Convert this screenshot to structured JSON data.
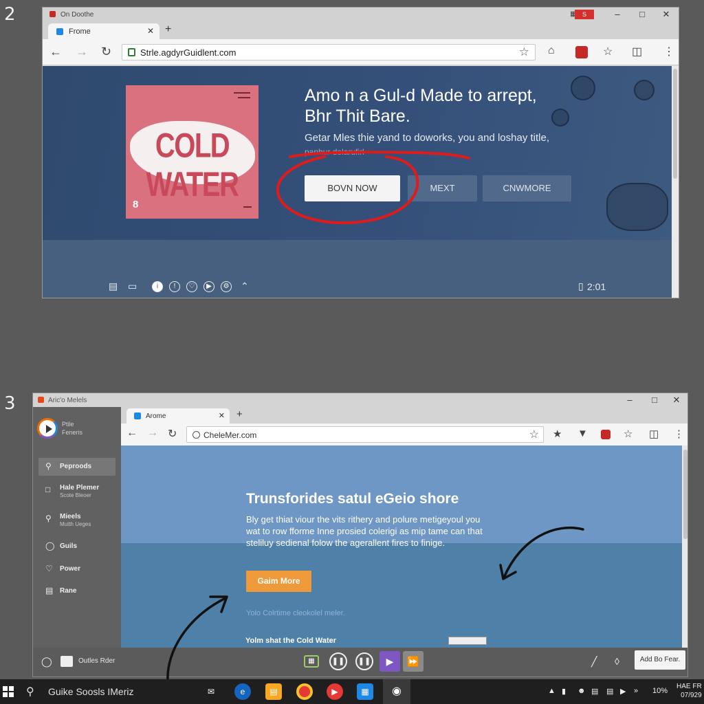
{
  "step_numbers": {
    "first": "2",
    "second": "3"
  },
  "window_a": {
    "title": "On Doothe",
    "tab_label": "Frome",
    "url": "Strle.agdyrGuidlent.com",
    "headline_line1": "Amo n a Gul-d Made to arrept,",
    "headline_line2": "Bhr Thit Bare.",
    "subtitle": "Getar Mles thie yand to doworks, you and loshay title,",
    "subtitle_faded": "panhur delarufirl",
    "album_title": "COLD WATER",
    "album_mark": "8",
    "buttons": {
      "primary": "BOVN NOW",
      "next": "MEXT",
      "more": "CNWMORE"
    },
    "time": "2:01",
    "slides": {
      "count": 3,
      "active_index": 2
    },
    "annotation_color": "#e01b1b"
  },
  "window_b": {
    "title": "Aric'o Melels",
    "brand_line1": "Ptile",
    "brand_line2": "Feneris",
    "tab_label": "Arome",
    "url": "CheleMer.com",
    "sidebar": [
      {
        "label": "Peproods",
        "sub": "",
        "icon": "search-icon",
        "selected": true
      },
      {
        "label": "Hale Plemer",
        "sub": "Scote Bleoer",
        "icon": "square-icon",
        "selected": false
      },
      {
        "label": "Mieels",
        "sub": "Mutth Ueges",
        "icon": "pin-icon",
        "selected": false
      },
      {
        "label": "Guils",
        "sub": "",
        "icon": "circle-icon",
        "selected": false
      },
      {
        "label": "Power",
        "sub": "",
        "icon": "puzzle-icon",
        "selected": false
      },
      {
        "label": "Rane",
        "sub": "",
        "icon": "film-icon",
        "selected": false
      }
    ],
    "heading": "Trunsforides satul eGeio shore",
    "paragraph": "Bly get thiat viour the vits rithery and polure metigeyoul you wat to row fforme Inne prosied colerigi as mip tame can that steliluy sedienal folow the agerallent fires to finige.",
    "cta": "Gaim More",
    "note": "Yolo Colrtime cleokolel meler.",
    "caption": "Yolm shat the Cold Water",
    "bottom_label": "Outles Rder",
    "add_button": "Add Bo Fear.",
    "accent_color": "#ef9a3a"
  },
  "taskbar": {
    "search_text": "Guike Soosls IMeriz",
    "battery": "10%",
    "clock_time": "HAE FR",
    "clock_date": "07/929"
  }
}
